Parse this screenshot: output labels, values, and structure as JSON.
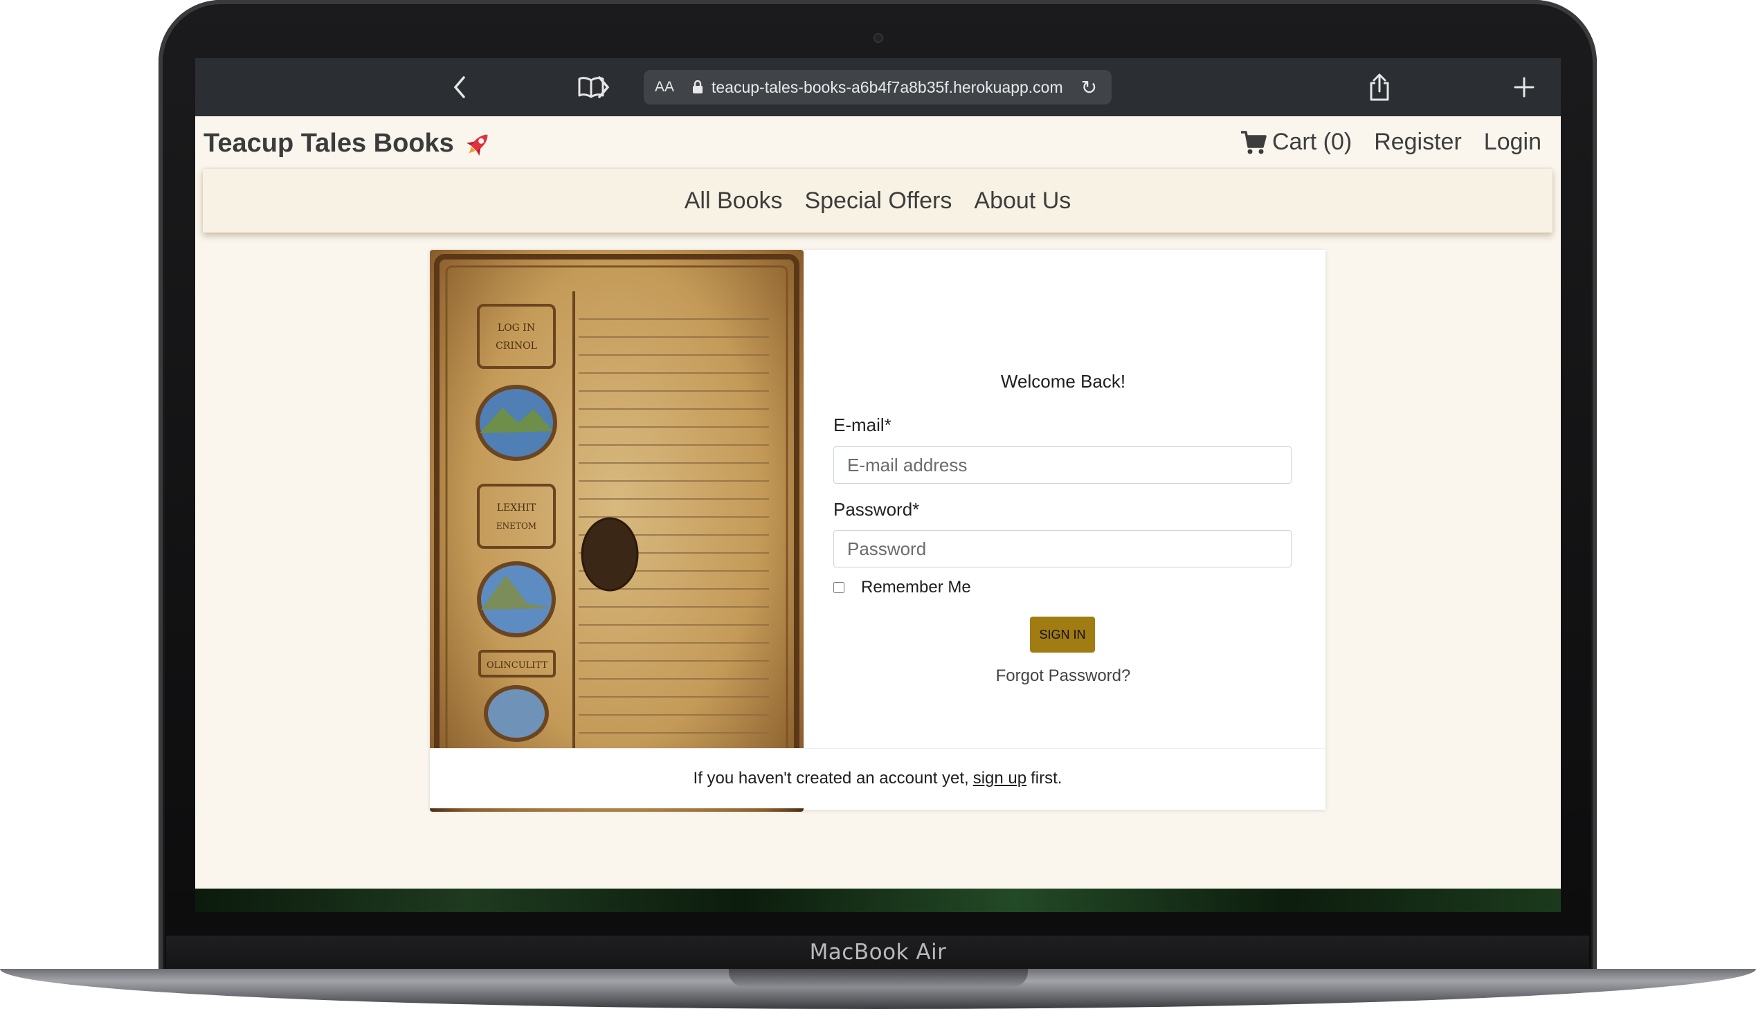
{
  "device": {
    "label": "MacBook Air"
  },
  "browser": {
    "text_size_label": "AA",
    "url": "teacup-tales-books-a6b4f7a8b35f.herokuapp.com"
  },
  "header": {
    "brand": "Teacup Tales Books",
    "cart": "Cart (0)",
    "register": "Register",
    "login": "Login"
  },
  "nav": [
    "All Books",
    "Special Offers",
    "About Us"
  ],
  "form": {
    "welcome": "Welcome Back!",
    "email_label": "E-mail*",
    "email_placeholder": "E-mail address",
    "password_label": "Password*",
    "password_placeholder": "Password",
    "remember_label": "Remember Me",
    "remember_checked": false,
    "sign_in_button": "SIGN IN",
    "forgot_password": "Forgot Password?"
  },
  "signup_prompt": {
    "before": "If you haven't created an account yet,",
    "link": "sign up",
    "after": "first."
  },
  "image_text": [
    "LOG IN",
    "CRINOL",
    "LEXHIT",
    "ENETOM",
    "OLINCULITT"
  ],
  "colors": {
    "toolbar": "#2b2e32",
    "page_background": "#faf6ee",
    "nav_background": "#f8f2e4",
    "sign_in_button": "#a07c12",
    "rocket": "#e0313c"
  }
}
